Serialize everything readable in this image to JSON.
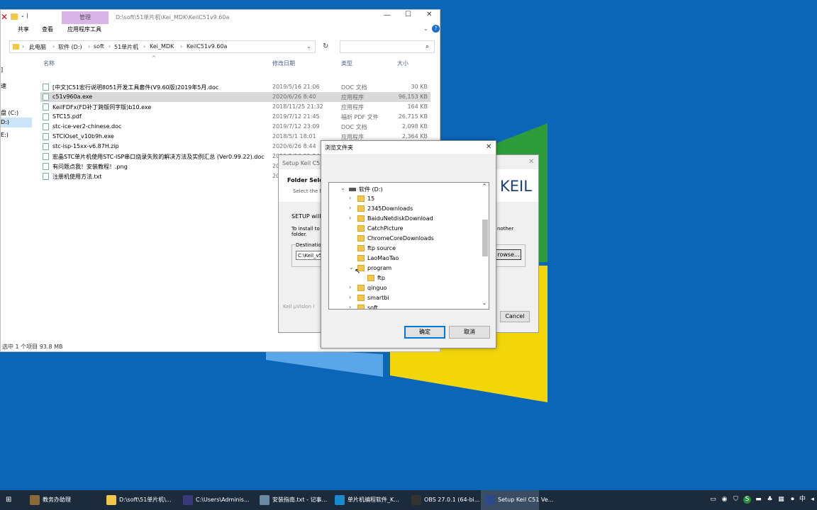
{
  "explorer": {
    "ribbon_tab_manage": "管理",
    "title_path": "D:\\soft\\51单片机\\Kei_MDK\\KeilC51v9.60a",
    "tabs": [
      "共享",
      "查看",
      "应用程序工具"
    ],
    "breadcrumb": [
      "此电脑",
      "软件 (D:)",
      "soft",
      "51单片机",
      "Kei_MDK",
      "KeilC51v9.60a"
    ],
    "columns": {
      "name": "名称",
      "date": "修改日期",
      "type": "类型",
      "size": "大小"
    },
    "files": [
      {
        "name": "[中文]C51宏行说明8051开发工具套件(V9.60版)2019年5月.doc",
        "date": "2019/5/16 21:06",
        "type": "DOC 文档",
        "size": "30 KB"
      },
      {
        "name": "c51v960a.exe",
        "date": "2020/6/26 8:40",
        "type": "应用程序",
        "size": "96,153 KB"
      },
      {
        "name": "KeilFDFx(FD补丁跨版同字版)b10.exe",
        "date": "2018/11/25 21:32",
        "type": "应用程序",
        "size": "164 KB"
      },
      {
        "name": "STC15.pdf",
        "date": "2019/7/12 21:45",
        "type": "福昕 PDF 文件",
        "size": "26,715 KB"
      },
      {
        "name": "stc-ice-ver2-chinese.doc",
        "date": "2019/7/12 23:09",
        "type": "DOC 文档",
        "size": "2,098 KB"
      },
      {
        "name": "STCIOset_v10b9h.exe",
        "date": "2018/5/1 18:01",
        "type": "应用程序",
        "size": "2,364 KB"
      },
      {
        "name": "stc-isp-15xx-v6.87H.zip",
        "date": "2020/6/26 8:44",
        "type": "好压 ZIP 压缩文件",
        "size": "23,812 KB"
      },
      {
        "name": "宏晶STC单片机使用STC-ISP串口烧录失败的解决方法及实例汇总 (Ver0.99.22).doc",
        "date": "2019/5/16 21:24",
        "type": "",
        "size": ""
      },
      {
        "name": "有问题点我！安装教程！.png",
        "date": "20",
        "type": "",
        "size": ""
      },
      {
        "name": "注册机使用方法.txt",
        "date": "20",
        "type": "",
        "size": ""
      }
    ],
    "nav": [
      "]",
      "速",
      "",
      "盘 (C:)",
      "D:)",
      "E:)"
    ],
    "status": "选中 1 个项目  93.8 MB"
  },
  "setup": {
    "title": "Setup Keil C51",
    "section": "Folder Selec",
    "sub": "Select the fo",
    "line1": "SETUP will in",
    "line2": "To install to th",
    "line3": "folder.",
    "group": "Destination",
    "path": "C:\\Keil_v5",
    "brand": "KEIL",
    "other": "nother",
    "browse": "rowse...",
    "footer": "Keil µVision I",
    "cancel": "Cancel"
  },
  "dialog": {
    "title": "浏览文件夹",
    "root": "软件 (D:)",
    "items": [
      {
        "label": "15",
        "expand": "›",
        "indent": 1
      },
      {
        "label": "2345Downloads",
        "expand": "›",
        "indent": 1
      },
      {
        "label": "BaiduNetdiskDownload",
        "expand": "›",
        "indent": 1
      },
      {
        "label": "CatchPicture",
        "expand": "",
        "indent": 1
      },
      {
        "label": "ChromeCoreDownloads",
        "expand": "",
        "indent": 1
      },
      {
        "label": "ftp source",
        "expand": "",
        "indent": 1
      },
      {
        "label": "LaoMaoTao",
        "expand": "",
        "indent": 1
      },
      {
        "label": "program",
        "expand": "⌄",
        "indent": 1
      },
      {
        "label": "ftp",
        "expand": "",
        "indent": 2
      },
      {
        "label": "qinguo",
        "expand": "›",
        "indent": 1
      },
      {
        "label": "smartbi",
        "expand": "›",
        "indent": 1
      },
      {
        "label": "soft",
        "expand": "›",
        "indent": 1
      }
    ],
    "ok": "确定",
    "cancel": "取消"
  },
  "taskbar": {
    "items": [
      {
        "label": "教务办助理",
        "color": "#8a6a3a"
      },
      {
        "label": "D:\\soft\\51单片机\\...",
        "color": "#f3c74b"
      },
      {
        "label": "C:\\Users\\Adminis...",
        "color": "#3a3a7a"
      },
      {
        "label": "安装指南.txt - 记事...",
        "color": "#6a8aa0"
      },
      {
        "label": "单片机编程软件_K...",
        "color": "#1a8ad0"
      },
      {
        "label": "OBS 27.0.1 (64-bi...",
        "color": "#333333"
      },
      {
        "label": "Setup Keil C51 Ve...",
        "color": "#2a4a8a"
      }
    ],
    "ime": "中",
    "notification": "S"
  }
}
